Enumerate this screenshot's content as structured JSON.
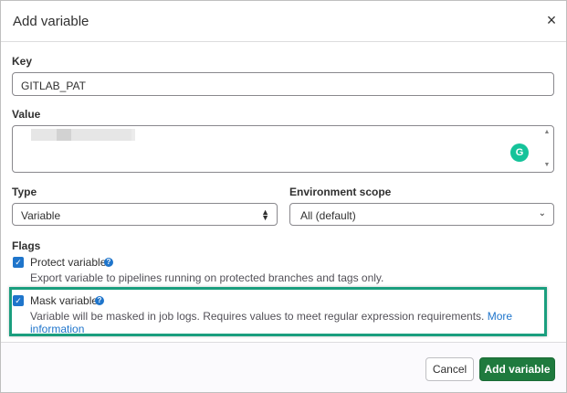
{
  "dialog": {
    "title": "Add variable",
    "close_glyph": "×"
  },
  "key": {
    "label": "Key",
    "value": "GITLAB_PAT"
  },
  "value_field": {
    "label": "Value",
    "grammarly_glyph": "G"
  },
  "type_field": {
    "label": "Type",
    "selected": "Variable"
  },
  "environment": {
    "label": "Environment scope",
    "selected": "All (default)"
  },
  "flags": {
    "label": "Flags",
    "protect": {
      "label": "Protect variable",
      "checked": true,
      "description": "Export variable to pipelines running on protected branches and tags only."
    },
    "mask": {
      "label": "Mask variable",
      "checked": true,
      "description": "Variable will be masked in job logs. Requires values to meet regular expression requirements.",
      "link_text": "More information"
    }
  },
  "footer": {
    "cancel_label": "Cancel",
    "add_label": "Add variable"
  },
  "colors": {
    "primary": "#1f75cb",
    "confirm": "#1f7a3e",
    "highlight": "#1a9e7e",
    "grammarly": "#15c39a"
  },
  "icons": {
    "close": "close-icon",
    "check": "check-icon",
    "help": "question-circle-icon",
    "select": "chevron-updown-icon",
    "dropdown": "chevron-down-icon",
    "grammarly": "grammarly-icon"
  }
}
